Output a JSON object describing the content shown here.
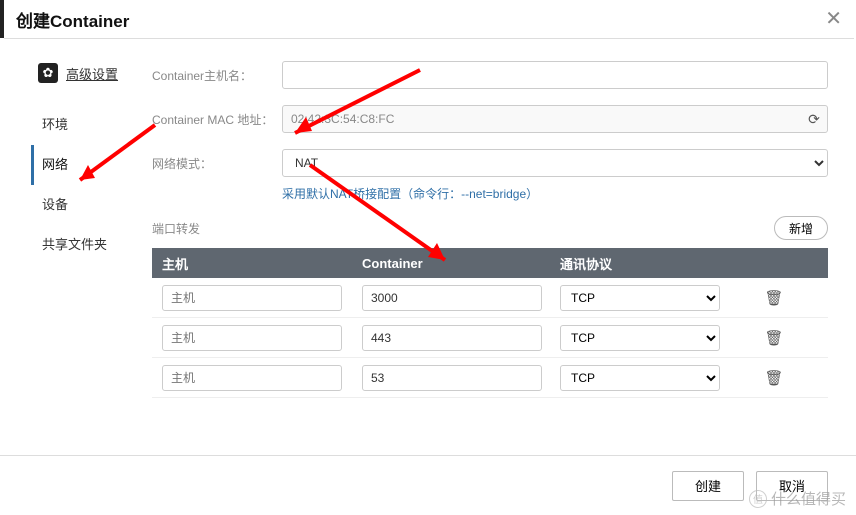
{
  "dialog": {
    "title": "创建Container"
  },
  "sidebar": {
    "advanced_label": "高级设置",
    "items": [
      {
        "label": "环境"
      },
      {
        "label": "网络"
      },
      {
        "label": "设备"
      },
      {
        "label": "共享文件夹"
      }
    ]
  },
  "form": {
    "hostname_label": "Container主机名：",
    "hostname_value": "",
    "mac_label": "Container MAC 地址：",
    "mac_value": "02:42:3C:54:C8:FC",
    "netmode_label": "网络模式：",
    "netmode_value": "NAT",
    "nat_note": "采用默认NAT桥接配置（命令行：--net=bridge）",
    "port_section_label": "端口转发",
    "add_label": "新增"
  },
  "table": {
    "headers": {
      "host": "主机",
      "container": "Container",
      "proto": "通讯协议"
    },
    "rows": [
      {
        "host_ph": "主机",
        "container": "3000",
        "proto": "TCP"
      },
      {
        "host_ph": "主机",
        "container": "443",
        "proto": "TCP"
      },
      {
        "host_ph": "主机",
        "container": "53",
        "proto": "TCP"
      }
    ]
  },
  "footer": {
    "create": "创建",
    "cancel": "取消"
  },
  "watermark": "什么值得买"
}
